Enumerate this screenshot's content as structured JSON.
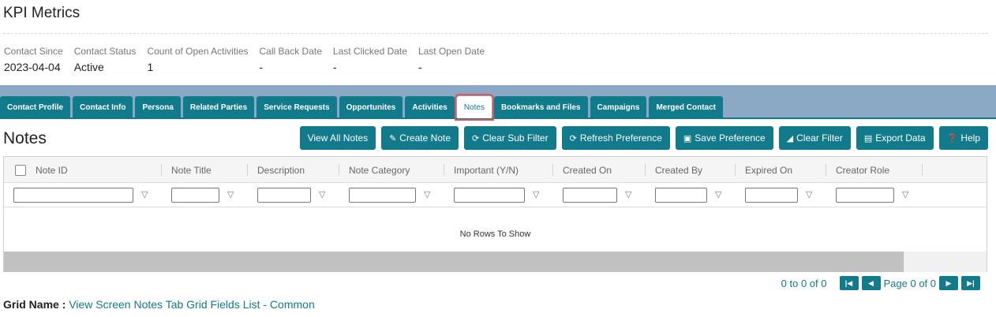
{
  "kpi": {
    "title": "KPI Metrics",
    "fields": [
      {
        "label": "Contact Since",
        "value": "2023-04-04"
      },
      {
        "label": "Contact Status",
        "value": "Active"
      },
      {
        "label": "Count of Open Activities",
        "value": "1"
      },
      {
        "label": "Call Back Date",
        "value": "-"
      },
      {
        "label": "Last Clicked Date",
        "value": "-"
      },
      {
        "label": "Last Open Date",
        "value": "-"
      }
    ]
  },
  "tabs": [
    "Contact Profile",
    "Contact Info",
    "Persona",
    "Related Parties",
    "Service Requests",
    "Opportunites",
    "Activities",
    "Notes",
    "Bookmarks and Files",
    "Campaigns",
    "Merged Contact"
  ],
  "active_tab": "Notes",
  "notes": {
    "heading": "Notes",
    "toolbar": [
      {
        "label": "View All Notes",
        "icon": ""
      },
      {
        "label": "Create Note",
        "icon": "edit-icon"
      },
      {
        "label": "Clear Sub Filter",
        "icon": "refresh-icon"
      },
      {
        "label": "Refresh Preference",
        "icon": "refresh-icon"
      },
      {
        "label": "Save Preference",
        "icon": "save-icon"
      },
      {
        "label": "Clear Filter",
        "icon": "eraser-icon"
      },
      {
        "label": "Export Data",
        "icon": "file-export-icon"
      },
      {
        "label": "Help",
        "icon": "help-icon"
      }
    ],
    "columns": [
      "Note ID",
      "Note Title",
      "Description",
      "Note Category",
      "Important (Y/N)",
      "Created On",
      "Created By",
      "Expired On",
      "Creator Role"
    ],
    "empty_text": "No Rows To Show"
  },
  "pager": {
    "range": "0 to 0 of 0",
    "page_text": "Page 0 of 0"
  },
  "grid_name": {
    "label": "Grid Name :",
    "value": "View Screen Notes Tab Grid Fields List - Common"
  },
  "colors": {
    "accent": "#117a8b",
    "tab_band": "#8ba9c4",
    "active_tab_outline": "#e0555b"
  }
}
